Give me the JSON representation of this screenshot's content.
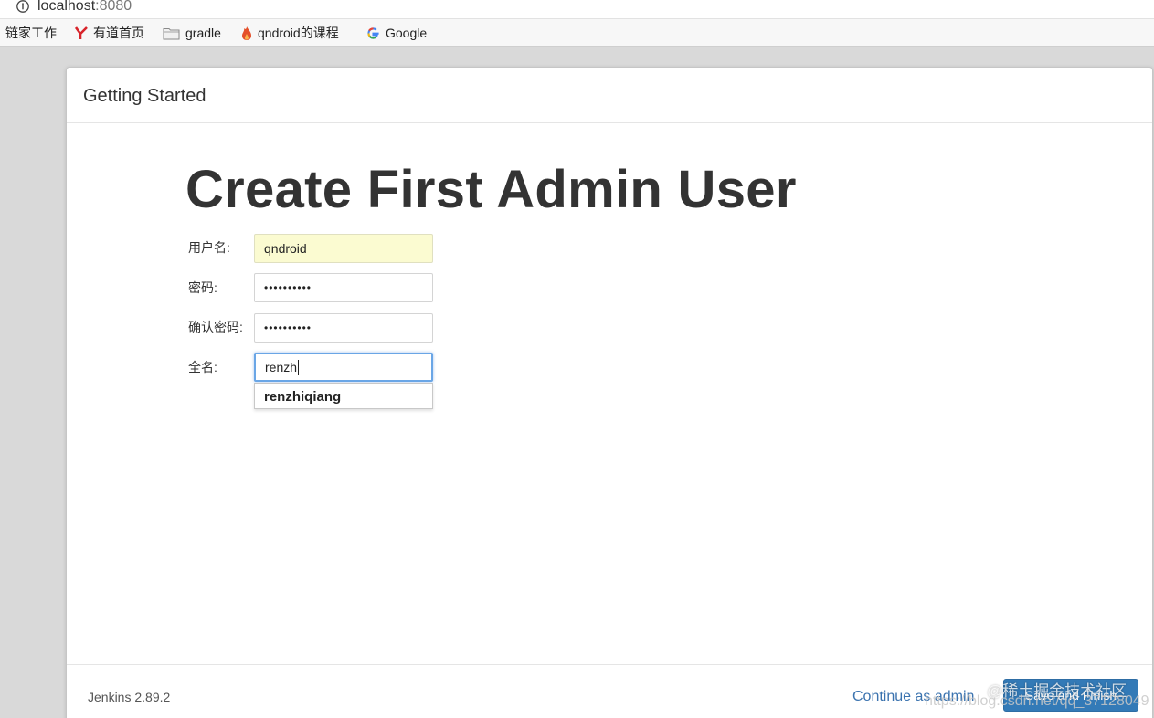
{
  "browser": {
    "url_host": "localhost",
    "url_port": ":8080",
    "bookmarks": [
      {
        "label": "链家工作",
        "icon": ""
      },
      {
        "label": "有道首页",
        "icon": "youdao-icon"
      },
      {
        "label": "gradle",
        "icon": "folder-icon"
      },
      {
        "label": "qndroid的课程",
        "icon": "flame-icon"
      },
      {
        "label": "Google",
        "icon": "google-icon"
      }
    ]
  },
  "dialog": {
    "header_title": "Getting Started",
    "page_title": "Create First Admin User",
    "form": {
      "username": {
        "label": "用户名:",
        "value": "qndroid"
      },
      "password": {
        "label": "密码:",
        "value": "••••••••••"
      },
      "confirm_password": {
        "label": "确认密码:",
        "value": "••••••••••"
      },
      "fullname": {
        "label": "全名:",
        "value": "renzh"
      }
    },
    "autocomplete": {
      "suggestion": "renzhiqiang"
    },
    "footer": {
      "version": "Jenkins 2.89.2",
      "continue_label": "Continue as admin",
      "save_label": "Save and Finish"
    }
  },
  "watermark": {
    "text": "@稀土掘金技术社区",
    "url": "https://blog.csdn.net/qq_37128049"
  },
  "colors": {
    "accent": "#337ab7",
    "link": "#3b73af",
    "autofill_bg": "#fbfbd1",
    "focus_border": "#6aa6e6"
  }
}
